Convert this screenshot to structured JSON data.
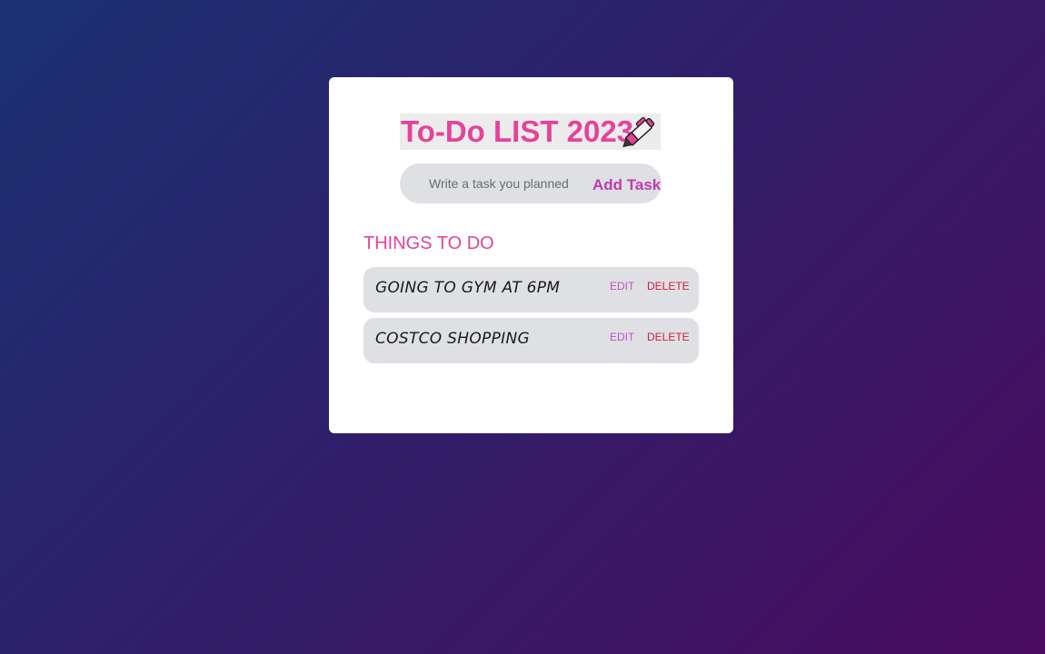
{
  "app": {
    "title": "To-Do LIST 2023",
    "title_icon": "pen-icon"
  },
  "add_form": {
    "placeholder": "Write a task you planned",
    "value": "",
    "button_label": "Add Task"
  },
  "section": {
    "heading": "THINGS TO DO"
  },
  "tasks": [
    {
      "text": "GOING TO GYM AT 6PM",
      "edit_label": "EDIT",
      "delete_label": "DELETE"
    },
    {
      "text": "COSTCO SHOPPING",
      "edit_label": "EDIT",
      "delete_label": "DELETE"
    }
  ],
  "colors": {
    "accent_pink": "#e5429a",
    "add_button": "#c03ab0",
    "edit": "#c452c8",
    "delete": "#d0203e",
    "item_bg": "#dfe0e4",
    "bg_gradient_start": "#1b3272",
    "bg_gradient_end": "#4a0c60"
  }
}
